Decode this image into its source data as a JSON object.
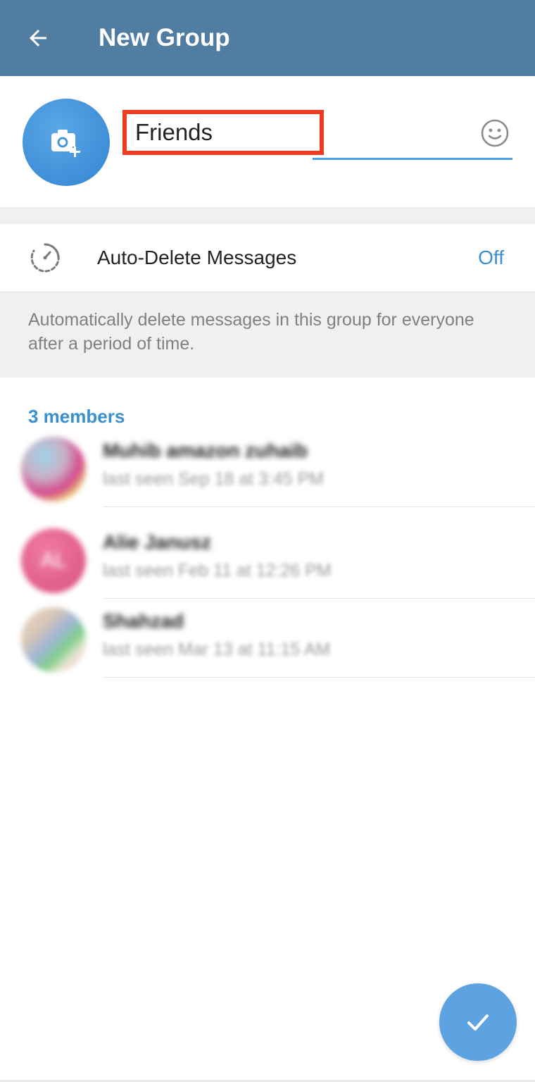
{
  "app_bar": {
    "title": "New Group",
    "color": "#517da2"
  },
  "group_info": {
    "avatar_icon": "camera-add-icon",
    "name_value": "Friends",
    "emoji_icon": "smiley-icon"
  },
  "auto_delete": {
    "icon": "timer-icon",
    "label": "Auto-Delete Messages",
    "value": "Off",
    "description": "Automatically delete messages in this group for everyone after a period of time."
  },
  "members": {
    "header": "3 members",
    "items": [
      {
        "name": "Muhib amazon zuhaib",
        "status": "last seen Sep 18 at 3:45 PM",
        "avatar_type": "photo"
      },
      {
        "name": "Alie Janusz",
        "status": "last seen Feb 11 at 12:26 PM",
        "avatar_type": "initials",
        "initials": "AL",
        "avatar_color": "#e05c87"
      },
      {
        "name": "Shahzad",
        "status": "last seen Mar 13 at 11:15 AM",
        "avatar_type": "photo"
      }
    ]
  },
  "fab": {
    "icon": "checkmark-icon",
    "color": "#5ea3e1"
  },
  "colors": {
    "accent": "#3a8fcf",
    "highlight_border": "#ee3b23"
  }
}
